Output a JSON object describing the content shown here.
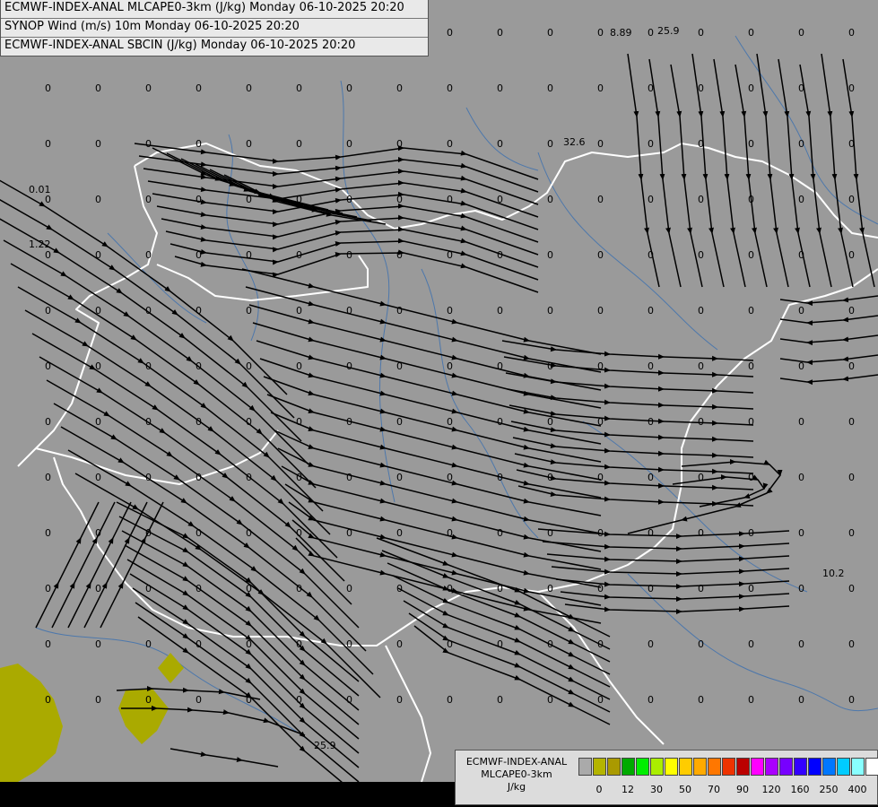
{
  "map": {
    "title_lines": [
      "ECMWF-INDEX-ANAL MLCAPE0-3km (J/kg) Monday 06-10-2025 20:20",
      "SYNOP Wind (m/s) 10m Monday 06-10-2025 20:20",
      "ECMWF-INDEX-ANAL SBCIN (J/kg) Monday 06-10-2025 20:20"
    ],
    "value_labels": [
      "8.89",
      "25.9",
      "32.6",
      "0.01",
      "1.22",
      "10.2",
      "25.9"
    ],
    "zero_label": "0"
  },
  "legend": {
    "title_line1": "ECMWF-INDEX-ANAL",
    "title_line2": "MLCAPE0-3km",
    "unit": "J/kg",
    "colors": [
      "#aaaaaa",
      "#b4b400",
      "#aa9a00",
      "#00aa00",
      "#00ee00",
      "#aaee00",
      "#ffff00",
      "#ffcc00",
      "#ffaa00",
      "#ff7700",
      "#ee3300",
      "#bb0000",
      "#ff00ff",
      "#aa00ff",
      "#7700ff",
      "#3300ff",
      "#0000ff",
      "#0077ff",
      "#00ccff",
      "#88ffff",
      "#ffffff"
    ],
    "ticks": [
      "0",
      "12",
      "30",
      "50",
      "70",
      "90",
      "120",
      "160",
      "250",
      "400"
    ]
  }
}
